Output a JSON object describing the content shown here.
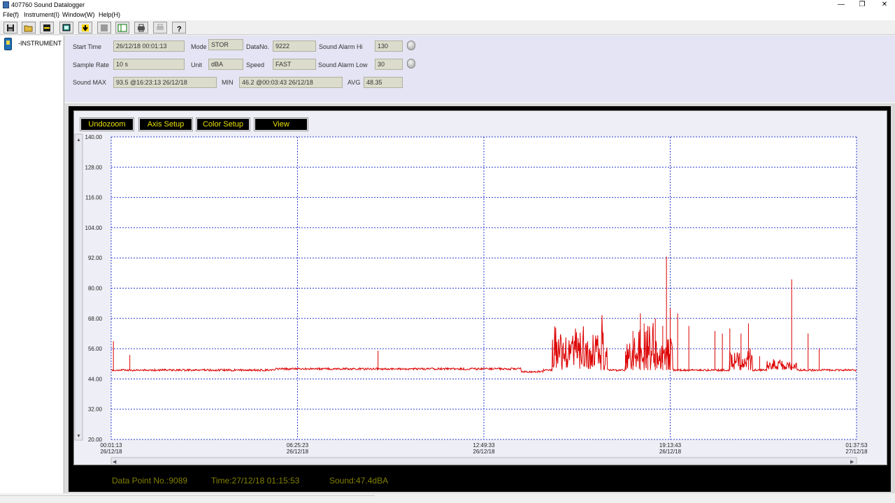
{
  "window": {
    "title": "407760 Sound Datalogger",
    "min": "—",
    "max": "❐",
    "close": "✕"
  },
  "menu": [
    "File(f)",
    "Instrument(I)",
    "Window(W)",
    "Help(H)"
  ],
  "toolbar_icons": [
    "save-icon",
    "open-icon",
    "connect-icon",
    "download-icon",
    "stop-icon",
    "monitor-icon",
    "print-icon",
    "setup-icon",
    "help-icon"
  ],
  "tree": {
    "item": "-INSTRUMENT"
  },
  "info": {
    "start_time_label": "Start Time",
    "start_time": "26/12/18 00:01:13",
    "mode_label": "Mode",
    "mode": "STOR",
    "datano_label": "DataNo.",
    "datano": "9222",
    "alarm_hi_label": "Sound Alarm Hi",
    "alarm_hi": "130",
    "sample_rate_label": "Sample Rate",
    "sample_rate": "10 s",
    "unit_label": "Unit",
    "unit": "dBA",
    "speed_label": "Speed",
    "speed": "FAST",
    "alarm_low_label": "Sound Alarm Low",
    "alarm_low": "30",
    "max_label": "Sound MAX",
    "max": "93.5 @16:23:13 26/12/18",
    "min_label": "MIN",
    "min": "46.2 @00:03:43 26/12/18",
    "avg_label": "AVG",
    "avg": "48.35"
  },
  "chart_buttons": {
    "undozoom": "Undozoom",
    "axis_setup": "Axis Setup",
    "color_setup": "Color Setup",
    "view": "View"
  },
  "status": {
    "data_point": "Data Point No.:9089",
    "time": "Time:27/12/18 01:15:53",
    "sound": "Sound:47.4dBA"
  },
  "chart_data": {
    "type": "line",
    "title": "",
    "xlabel": "",
    "ylabel": "",
    "ylim": [
      20,
      140
    ],
    "y_ticks": [
      "140.00",
      "128.00",
      "116.00",
      "104.00",
      "92.00",
      "80.00",
      "68.00",
      "56.00",
      "44.00",
      "32.00",
      "20.00"
    ],
    "x_ticks": [
      {
        "time": "00:01:13",
        "date": "26/12/18"
      },
      {
        "time": "06:25:23",
        "date": "26/12/18"
      },
      {
        "time": "12:49:33",
        "date": "26/12/18"
      },
      {
        "time": "19:13:43",
        "date": "26/12/18"
      },
      {
        "time": "01:37:53",
        "date": "27/12/18"
      }
    ],
    "grid": true,
    "line_color": "#dd0000",
    "baseline_db": 47.5,
    "series": [
      {
        "values_note_points": [
          [
            0.0,
            47.5
          ],
          [
            0.003,
            59.0
          ],
          [
            0.006,
            47.0
          ],
          [
            0.025,
            53.5
          ],
          [
            0.027,
            47.3
          ],
          [
            0.1,
            47.5
          ],
          [
            0.25,
            47.8
          ],
          [
            0.357,
            47.9
          ],
          [
            0.358,
            55.2
          ],
          [
            0.36,
            47.8
          ],
          [
            0.47,
            48.3
          ],
          [
            0.48,
            49.5
          ],
          [
            0.49,
            48.4
          ],
          [
            0.5,
            47.8
          ],
          [
            0.6,
            47.0
          ],
          [
            0.63,
            47.5
          ],
          [
            0.66,
            48.0
          ],
          [
            0.69,
            55.0
          ],
          [
            0.7,
            63.0
          ],
          [
            0.71,
            70.0
          ],
          [
            0.715,
            66.0
          ],
          [
            0.72,
            65.0
          ],
          [
            0.73,
            68.0
          ],
          [
            0.74,
            65.0
          ],
          [
            0.745,
            92.5
          ],
          [
            0.75,
            72.0
          ],
          [
            0.76,
            70.0
          ],
          [
            0.775,
            65.0
          ],
          [
            0.795,
            52.0
          ],
          [
            0.81,
            63.0
          ],
          [
            0.82,
            62.0
          ],
          [
            0.83,
            64.0
          ],
          [
            0.845,
            62.0
          ],
          [
            0.855,
            66.0
          ],
          [
            0.87,
            53.0
          ],
          [
            0.89,
            52.0
          ],
          [
            0.913,
            83.5
          ],
          [
            0.92,
            50.0
          ],
          [
            0.935,
            62.0
          ],
          [
            0.95,
            56.0
          ],
          [
            0.97,
            51.0
          ],
          [
            0.99,
            50.0
          ],
          [
            1.0,
            48.0
          ]
        ]
      }
    ]
  }
}
